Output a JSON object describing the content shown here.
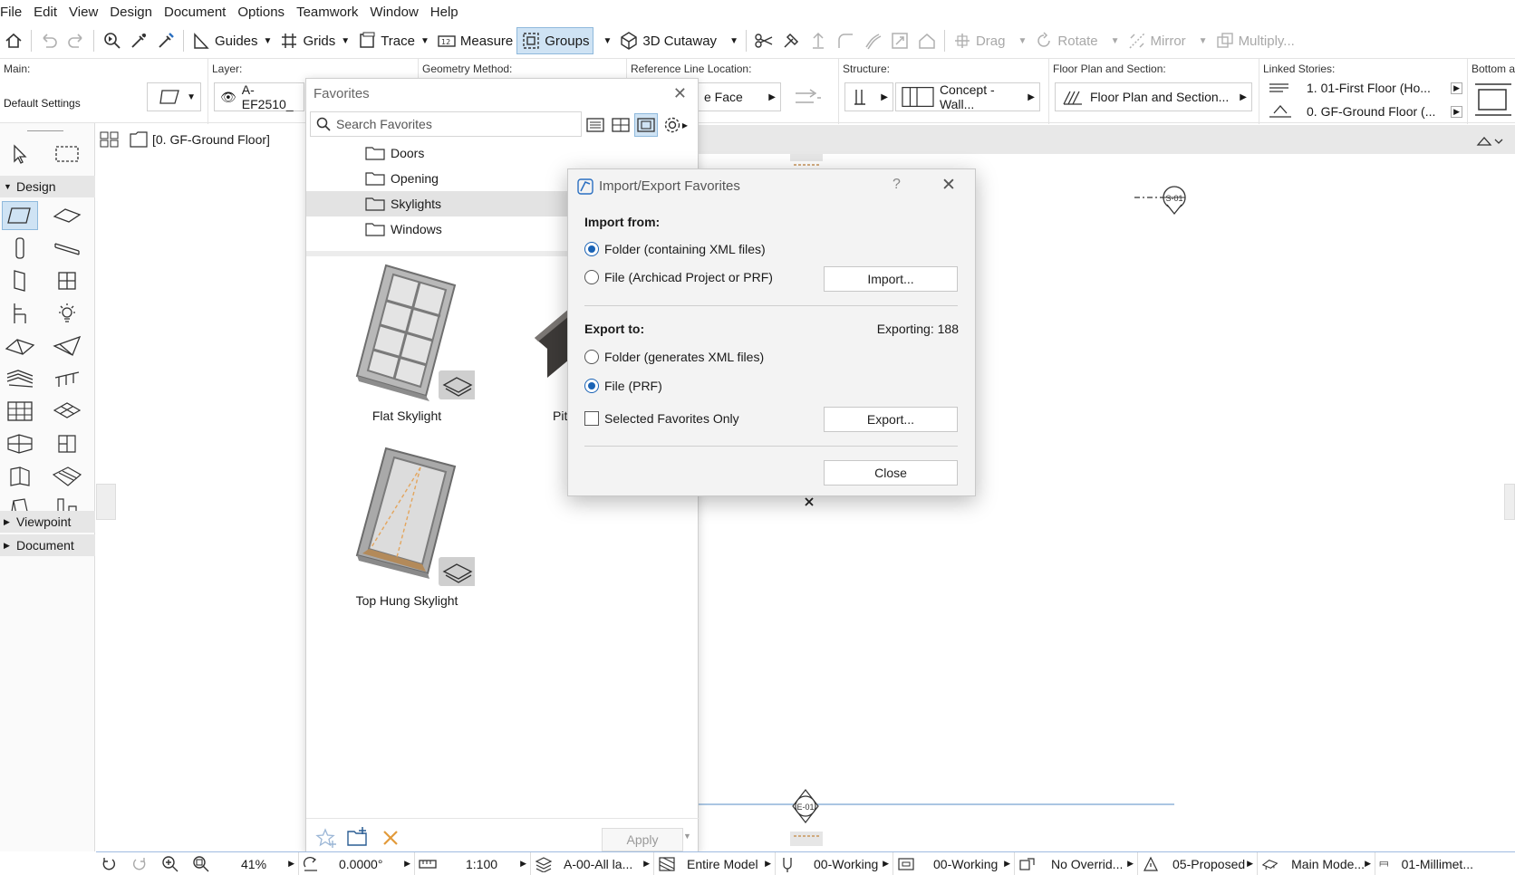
{
  "menu": [
    "File",
    "Edit",
    "View",
    "Design",
    "Document",
    "Options",
    "Teamwork",
    "Window",
    "Help"
  ],
  "toolbar": {
    "guides": "Guides",
    "grids": "Grids",
    "trace": "Trace",
    "measure": "Measure",
    "groups": "Groups",
    "cutaway": "3D Cutaway",
    "drag": "Drag",
    "rotate": "Rotate",
    "mirror": "Mirror",
    "multiply": "Multiply..."
  },
  "infobox": {
    "main_label": "Main:",
    "main_value": "Default Settings",
    "layer_label": "Layer:",
    "layer_value": "A-EF2510_",
    "geometry_label": "Geometry Method:",
    "refline_label": "Reference Line Location:",
    "refline_value": "e Face",
    "structure_label": "Structure:",
    "structure_value": "Concept - Wall...",
    "fps_label": "Floor Plan and Section:",
    "fps_value": "Floor Plan and Section...",
    "linked_label": "Linked Stories:",
    "linked_top": "1. 01-First Floor (Ho...",
    "linked_bottom": "0. GF-Ground Floor (...",
    "bottom_label": "Bottom ar"
  },
  "tab": {
    "label": "[0. GF-Ground Floor]"
  },
  "toolbox": {
    "design": "Design",
    "viewpoint": "Viewpoint",
    "document": "Document"
  },
  "favorites": {
    "title": "Favorites",
    "search_placeholder": "Search Favorites",
    "folders": [
      "Doors",
      "Opening",
      "Skylights",
      "Windows"
    ],
    "items": [
      "Flat Skylight",
      "Pit",
      "Top Hung Skylight"
    ],
    "apply": "Apply"
  },
  "dialog": {
    "title": "Import/Export Favorites",
    "help": "?",
    "import_from": "Import from:",
    "import_folder": "Folder (containing XML files)",
    "import_file": "File (Archicad Project or PRF)",
    "import_btn": "Import...",
    "export_to": "Export to:",
    "exporting": "Exporting: 188",
    "export_folder": "Folder (generates XML files)",
    "export_file": "File (PRF)",
    "selected_only": "Selected Favorites Only",
    "export_btn": "Export...",
    "close_btn": "Close"
  },
  "canvas": {
    "marker_top": "S-01",
    "marker_bottom": "E-01"
  },
  "statusbar": {
    "zoom": "41%",
    "angle": "0.0000°",
    "scale": "1:100",
    "layers": "A-00-All la...",
    "model": "Entire Model",
    "pen": "00-Working",
    "mvo": "00-Working",
    "override": "No Overrid...",
    "renovation": "05-Proposed",
    "view": "Main Mode...",
    "dimension": "01-Millimet..."
  },
  "colors": {
    "accent": "#1a63b5",
    "selection": "#cfe3f4",
    "canvas_line": "#8fb4d9"
  }
}
